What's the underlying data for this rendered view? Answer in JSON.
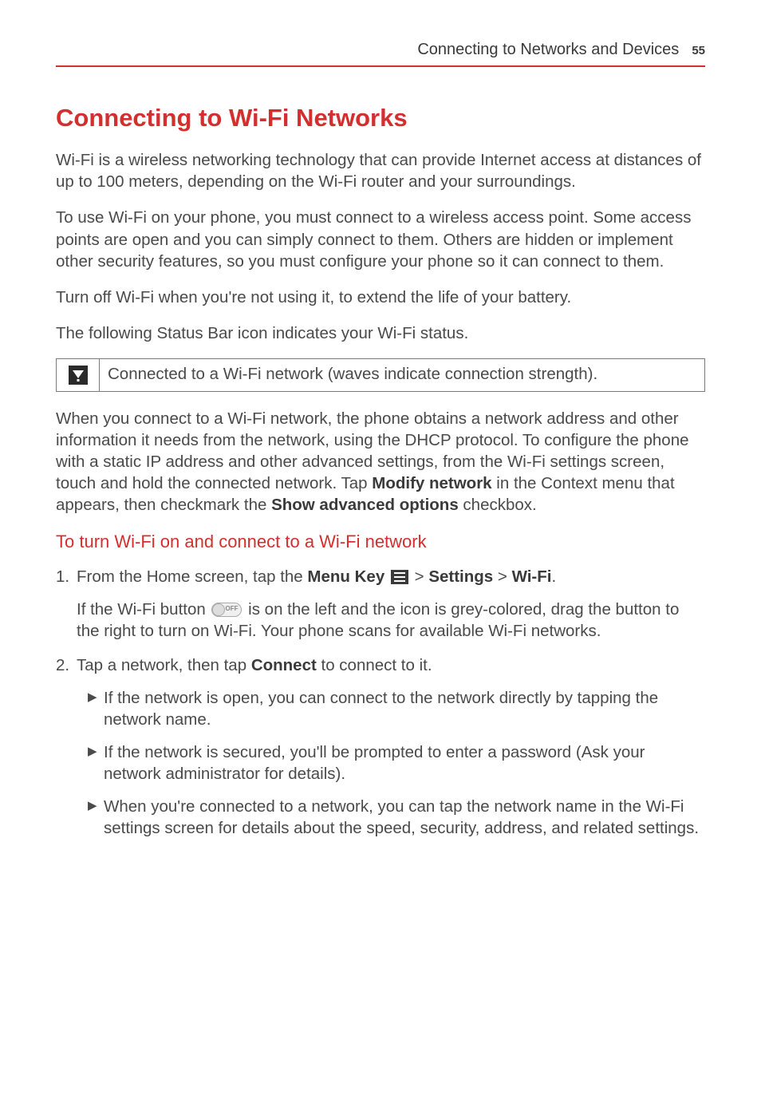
{
  "header": {
    "title": "Connecting to Networks and Devices",
    "page_number": "55"
  },
  "main_title": "Connecting to Wi-Fi Networks",
  "para1": "Wi-Fi is a wireless networking technology that can provide Internet access at distances of up to 100 meters, depending on the Wi-Fi router and your surroundings.",
  "para2": "To use Wi-Fi on your phone, you must connect to a wireless access point. Some access points are open and you can simply connect to them. Others are hidden or implement other security features, so you must configure your phone so it can connect to them.",
  "para3": "Turn off Wi-Fi when you're not using it, to extend the life of your battery.",
  "para4": "The following Status Bar icon indicates your Wi-Fi status.",
  "status_box": "Connected to a Wi-Fi network (waves indicate connection strength).",
  "para5_part1": "When you connect to a Wi-Fi network, the phone obtains a network address and other information it needs from the network, using the DHCP protocol. To configure the phone with a static IP address and other advanced settings, from the Wi-Fi settings screen, touch and hold the connected network. Tap ",
  "para5_bold1": "Modify network",
  "para5_part2": " in the Context menu that appears, then checkmark the ",
  "para5_bold2": "Show advanced options",
  "para5_part3": " checkbox.",
  "subtitle": "To turn Wi-Fi on and connect to a Wi-Fi network",
  "step1": {
    "num": "1.",
    "text1": " From the Home screen, tap the ",
    "bold1": "Menu Key ",
    "text2": " > ",
    "bold2": "Settings",
    "text3": " > ",
    "bold3": "Wi-Fi",
    "text4": "."
  },
  "step1_sub": {
    "text1": "If the Wi-Fi button ",
    "text2": " is on the left and the icon is grey-colored, drag the button to the right to turn on Wi-Fi. Your phone scans for available Wi-Fi networks."
  },
  "step2": {
    "num": "2.",
    "text1": " Tap a network, then tap ",
    "bold1": "Connect",
    "text2": " to connect to it."
  },
  "bullets": [
    "If the network is open, you can connect to the network directly by tapping the network name.",
    "If the network is secured, you'll be prompted to enter a password (Ask your network administrator for details).",
    "When you're connected to a network, you can tap the network name in the Wi-Fi settings screen for details about the speed, security, address, and related settings."
  ]
}
